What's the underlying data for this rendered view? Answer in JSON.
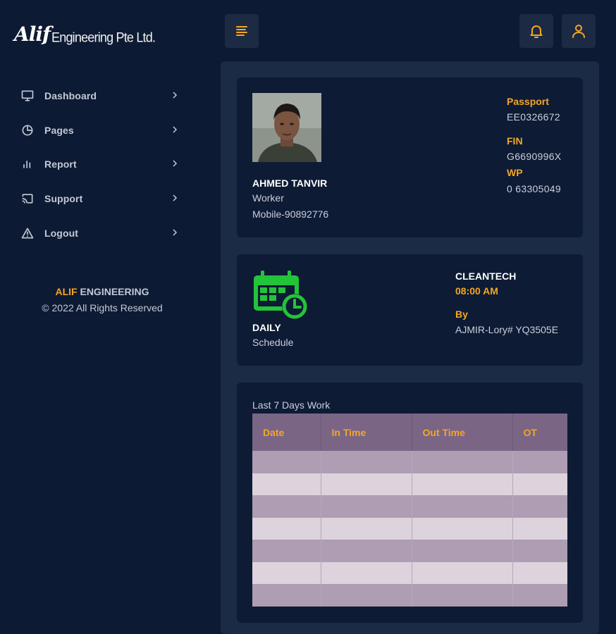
{
  "brand": {
    "logo": "Alif",
    "company": "Engineering Pte Ltd."
  },
  "sidebar": {
    "items": [
      {
        "label": "Dashboard",
        "icon": "monitor-icon"
      },
      {
        "label": "Pages",
        "icon": "pie-chart-icon"
      },
      {
        "label": "Report",
        "icon": "bar-chart-icon"
      },
      {
        "label": "Support",
        "icon": "cast-icon"
      },
      {
        "label": "Logout",
        "icon": "alert-triangle-icon"
      }
    ],
    "footer": {
      "brand_accent": "ALIF",
      "brand_rest": "ENGINEERING",
      "copyright": "© 2022 All Rights Reserved"
    }
  },
  "topbar": {
    "menu_icon": "menu-lines-icon",
    "notification_icon": "bell-icon",
    "user_icon": "user-icon"
  },
  "employee": {
    "name": "AHMED TANVIR",
    "role": "Worker",
    "mobile": "Mobile-90892776",
    "passport_label": "Passport",
    "passport": "EE0326672",
    "fin_label": "FIN",
    "fin": "G6690996X",
    "wp_label": "WP",
    "wp": "0 63305049"
  },
  "schedule": {
    "title": "DAILY",
    "subtitle": "Schedule",
    "company": "CLEANTECH",
    "time": "08:00 AM",
    "by_label": "By",
    "by": "AJMIR-Lory# YQ3505E",
    "icon": "calendar-clock-icon"
  },
  "work": {
    "title": "Last 7 Days Work",
    "columns": [
      "Date",
      "In Time",
      "Out Time",
      "OT"
    ],
    "rows": [
      [
        "",
        "",
        "",
        ""
      ],
      [
        "",
        "",
        "",
        ""
      ],
      [
        "",
        "",
        "",
        ""
      ],
      [
        "",
        "",
        "",
        ""
      ],
      [
        "",
        "",
        "",
        ""
      ],
      [
        "",
        "",
        "",
        ""
      ],
      [
        "",
        "",
        "",
        ""
      ]
    ]
  },
  "colors": {
    "accent": "#f5a623",
    "background": "#0d1a33",
    "panel": "#1b2a45",
    "card": "#0e1b35",
    "table_header": "#7a6585",
    "icon_green": "#22c43a"
  }
}
